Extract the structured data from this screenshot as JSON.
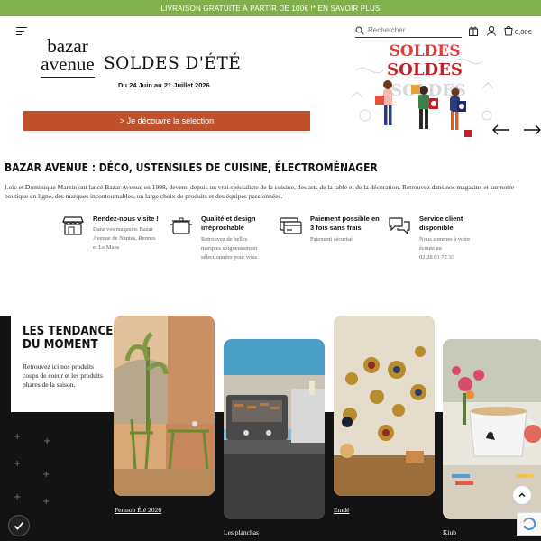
{
  "topbar": {
    "text": "LIVRAISON GRATUITE À PARTIR DE 100€ !* EN SAVOIR PLUS"
  },
  "header": {
    "search_placeholder": "Rechercher",
    "cart_amount": "0,00€",
    "icons": [
      "menu-icon",
      "search-icon",
      "gift-icon",
      "user-icon",
      "cart-icon"
    ]
  },
  "banner": {
    "logo_line1": "bazar",
    "logo_line2": "avenue",
    "title": "SOLDES D'ÉTÉ",
    "dates": "Du 24 Juin au 21 Juillet 2026",
    "cta": "> Je découvre la sélection",
    "illustration_words": [
      "SOLDES",
      "SOLDES",
      "SOLDES"
    ],
    "colors": {
      "cta": "#c0512a",
      "topbar": "#7fb04b"
    }
  },
  "intro": {
    "title": "BAZAR AVENUE : DÉCO, USTENSILES DE CUISINE, ÉLECTROMÉNAGER",
    "text": "Loïc et Dominique Marzin ont lancé Bazar Avenue en 1998, devenu depuis un vrai spécialiste de la cuisine, des arts de la table et de la décoration. Retrouvez dans nos magasins et sur notre boutique en ligne, des marques incontournables, un large choix de produits et des équipes passionnées."
  },
  "features": [
    {
      "icon": "store-icon",
      "title": "Rendez-nous visite !",
      "desc": "Dans vos magasins Bazar Avenue de Nantes, Rennes et Le Mans"
    },
    {
      "icon": "pot-icon",
      "title": "Qualité et design irréprochable",
      "desc": "Retrouvez de belles marques soigneusement sélectionnées pour vous"
    },
    {
      "icon": "credit-card-icon",
      "title": "Paiement possible en 3 fois sans frais",
      "desc": "Paiement sécurisé"
    },
    {
      "icon": "chat-icon",
      "title": "Service client disponible",
      "desc": "Nous sommes à votre écoute au",
      "phone": "02 28 01 72 33"
    }
  ],
  "trends": {
    "title_line1": "LES TENDANCES",
    "title_line2": "DU MOMENT",
    "desc": "Retrouvez ici nos produits coups de coeur et les produits phares de la saison.",
    "cards": [
      {
        "label": "Fermob Été 2026"
      },
      {
        "label": "Les planchas"
      },
      {
        "label": "Emdé"
      },
      {
        "label": "Kiub"
      }
    ]
  }
}
